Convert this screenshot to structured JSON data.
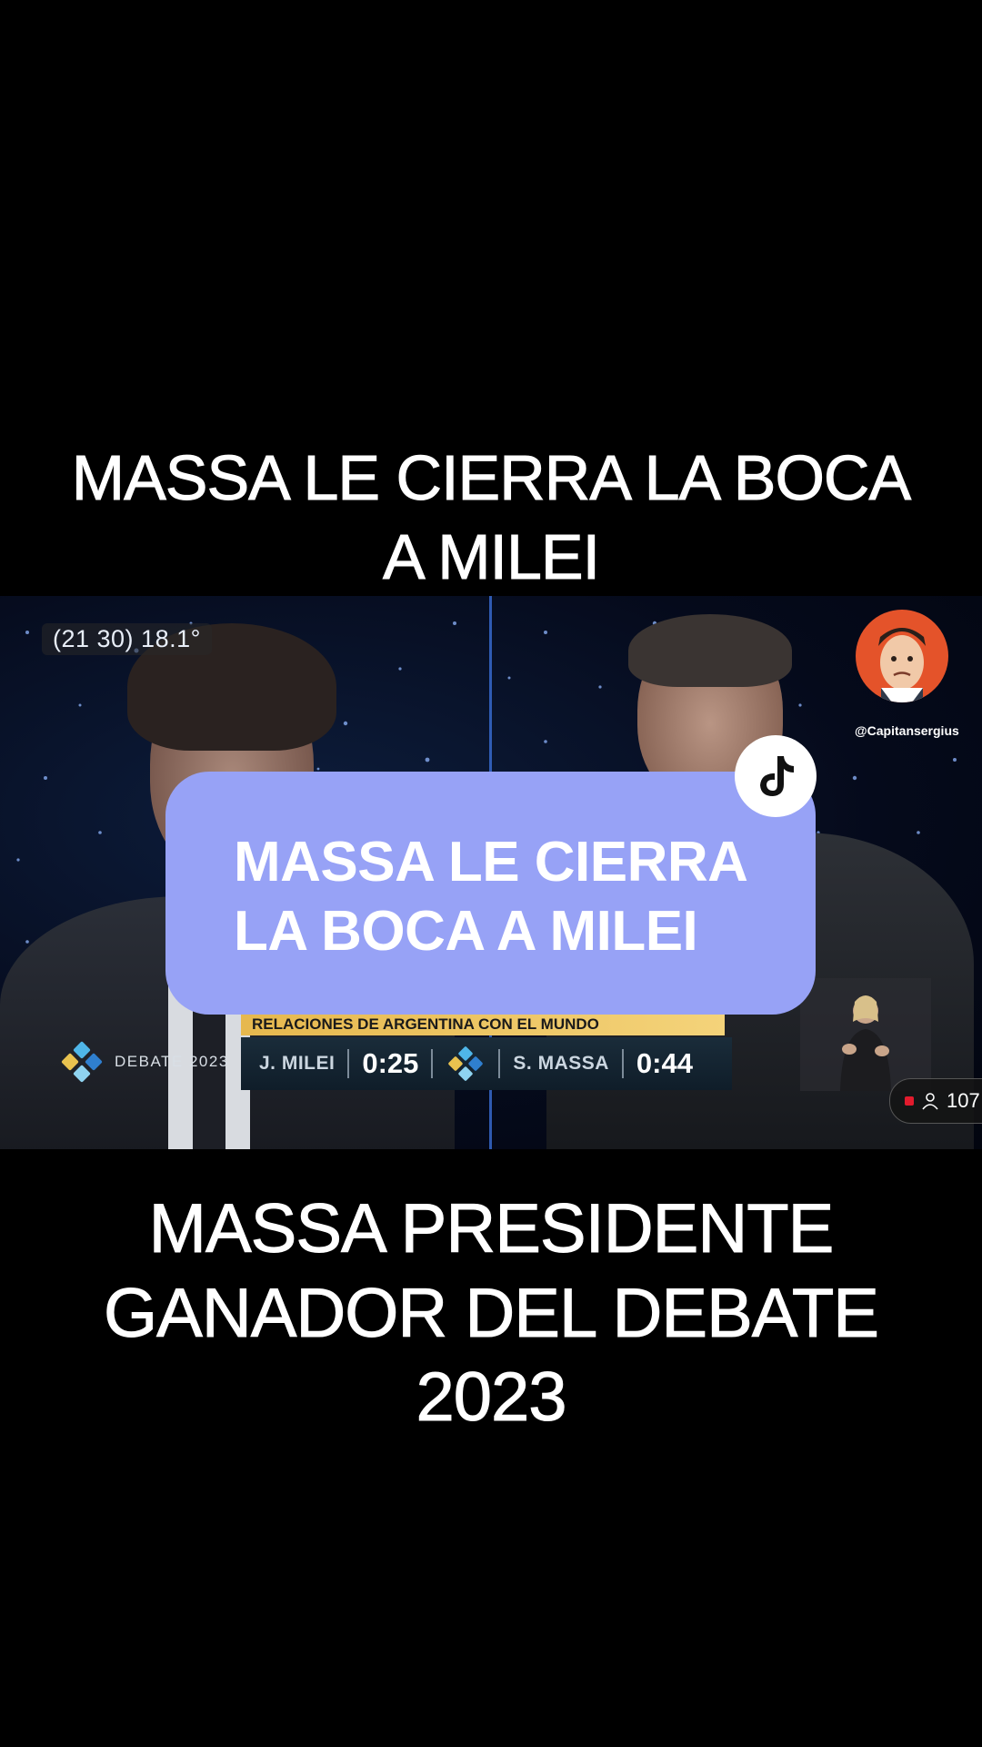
{
  "captions": {
    "top_line1": "MASSA LE CIERRA LA BOCA",
    "top_line2": "A MILEI",
    "bottom_line1": "MASSA PRESIDENTE",
    "bottom_line2": "GANADOR DEL DEBATE",
    "bottom_line3": "2023"
  },
  "video": {
    "time_weather": "(21 30) 18.1°",
    "creator_handle": "@Capitansergius",
    "debate_logo_text": "DEBATE 2023",
    "topic_banner": "RELACIONES DE ARGENTINA CON EL MUNDO",
    "candidate_left": "J. MILEI",
    "time_left": "0:25",
    "candidate_right": "S. MASSA",
    "time_right": "0:44",
    "viewer_count": "107"
  },
  "overlay_card": {
    "line1": "MASSA LE CIERRA",
    "line2": "LA BOCA A MILEI",
    "background": "#97a2f6"
  },
  "icons": {
    "tiktok": "tiktok-logo-icon",
    "viewer": "person-icon",
    "live": "live-dot-icon"
  }
}
